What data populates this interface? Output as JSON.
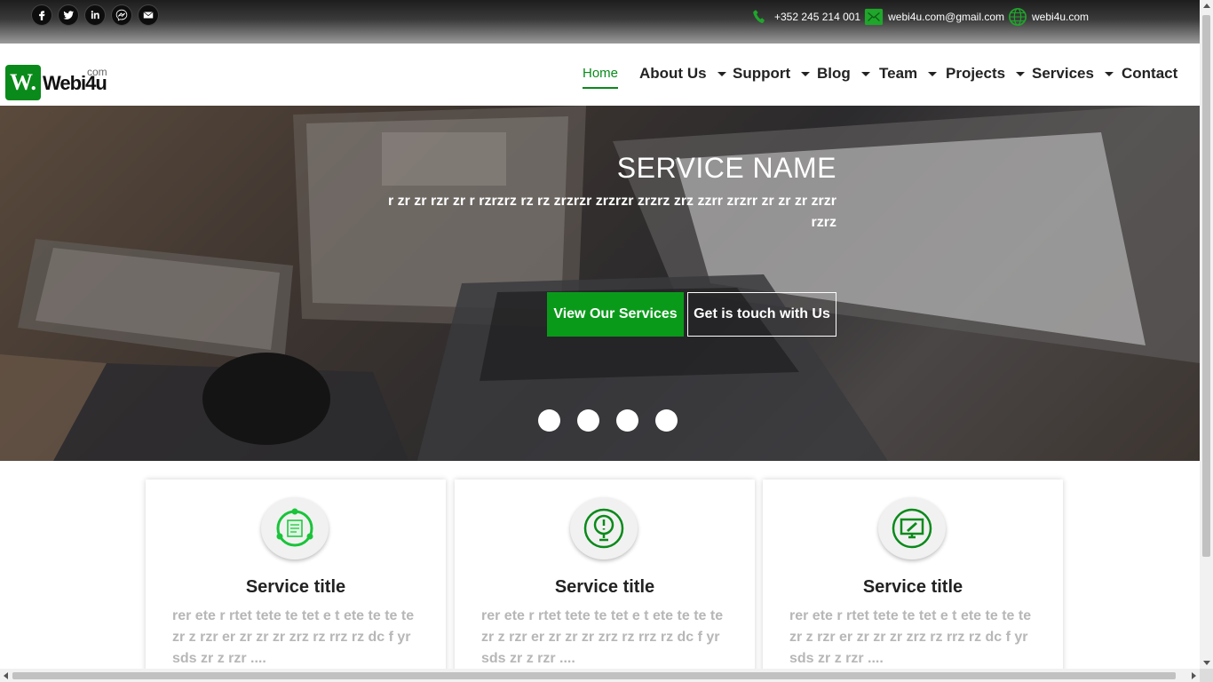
{
  "topbar": {
    "social": [
      {
        "icon": "facebook-icon",
        "glyph": "f"
      },
      {
        "icon": "twitter-icon",
        "glyph": "t"
      },
      {
        "icon": "linkedin-icon",
        "glyph": "in"
      },
      {
        "icon": "messenger-icon",
        "glyph": "m"
      },
      {
        "icon": "mail-icon",
        "glyph": "@"
      }
    ],
    "phone": "+352 245 214 001",
    "email": "webi4u.com@gmail.com",
    "website": "webi4u.com"
  },
  "logo": {
    "mark": "W.",
    "text": "Webi4u",
    "suffix": "com"
  },
  "nav": {
    "items": [
      "Home",
      "About Us",
      "Support",
      "Blog",
      "Team",
      "Projects",
      "Services",
      "Contact"
    ],
    "active": "Home"
  },
  "hero": {
    "title": "SERVICE NAME",
    "description": "r zr zr rzr zr r rzrzrz rz rz zrzrzr zrzrzr zrzrz zrz zzrr zrzrr zr zr zr zrzr rzrz",
    "primary_button": "View Our Services",
    "secondary_button": "Get is touch with Us",
    "slide_count": 4
  },
  "services": [
    {
      "icon": "document-cycle-icon",
      "title": "Service title",
      "text": "rer ete r rtet tete te tet e t ete te te te zr z rzr er zr zr zr zrz rz rrz rz dc f yr sds zr z rzr ...."
    },
    {
      "icon": "search-alert-icon",
      "title": "Service title",
      "text": "rer ete r rtet tete te tet e t ete te te te zr z rzr er zr zr zr zrz rz rrz rz dc f yr sds zr z rzr ...."
    },
    {
      "icon": "monitor-edit-icon",
      "title": "Service title",
      "text": "rer ete r rtet tete te tet e t ete te te te zr z rzr er zr zr zr zrz rz rrz rz dc f yr sds zr z rzr ...."
    }
  ],
  "colors": {
    "accent": "#0a9a1a",
    "text": "#222222",
    "muted": "#b7b7b7"
  }
}
